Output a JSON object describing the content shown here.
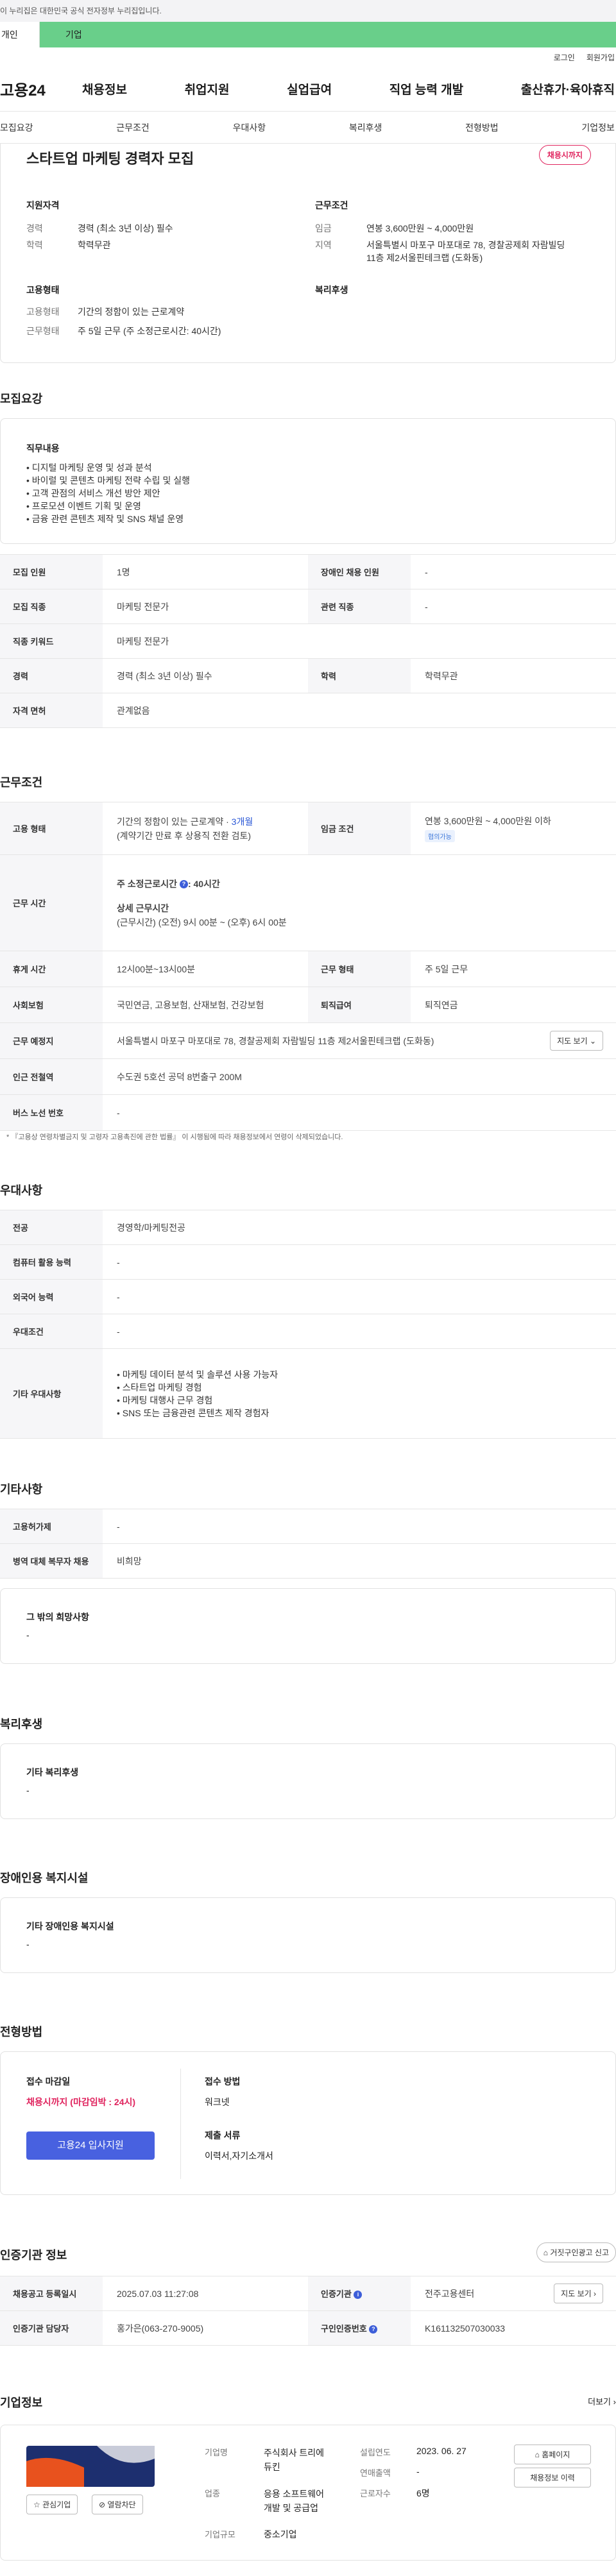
{
  "gov_banner": "이 누리집은 대한민국 공식 전자정부 누리집입니다.",
  "tabs": {
    "personal": "개인",
    "company": "기업"
  },
  "util": {
    "login": "로그인",
    "join": "회원가입"
  },
  "logo": "고용24",
  "gnb": [
    "채용정보",
    "취업지원",
    "실업급여",
    "직업 능력 개발",
    "출산휴가·육아휴직"
  ],
  "anchor_nav": [
    "모집요강",
    "근무조건",
    "우대사항",
    "복리후생",
    "전형방법",
    "기업정보"
  ],
  "summary": {
    "title": "스타트업 마케팅 경력자 모집",
    "status": "채용시까지",
    "qualification_title": "지원자격",
    "career_k": "경력",
    "career_v": "경력 (최소 3년 이상) 필수",
    "education_k": "학력",
    "education_v": "학력무관",
    "employment_title": "고용형태",
    "emp_type_k": "고용형태",
    "emp_type_v": "기간의 정함이 있는 근로계약",
    "work_type_k": "근무형태",
    "work_type_v": "주 5일 근무 (주 소정근로시간: 40시간)",
    "conditions_title": "근무조건",
    "wage_k": "임금",
    "wage_v": "연봉 3,600만원 ~ 4,000만원",
    "region_k": "지역",
    "region_v1": "서울특별시 마포구 마포대로 78, 경찰공제회 자람빌딩",
    "region_v2": "11층 제2서울핀테크랩 (도화동)",
    "welfare_title": "복리후생"
  },
  "recruit": {
    "section_title": "모집요강",
    "duties_title": "직무내용",
    "duties": [
      "디지털 마케팅 운영 및 성과 분석",
      "바이럴 및 콘텐츠 마케팅 전략 수립 및 실행",
      "고객 관점의 서비스 개선 방안 제안",
      "프로모션 이벤트 기획 및 운영",
      "금융 관련 콘텐츠 제작 및 SNS 채널 운영"
    ],
    "headcount_k": "모집 인원",
    "headcount_v": "1명",
    "disabled_k": "장애인 채용 인원",
    "disabled_v": "-",
    "job_k": "모집 직종",
    "job_v": "마케팅 전문가",
    "related_k": "관련 직종",
    "related_v": "-",
    "keyword_k": "직종 키워드",
    "keyword_v": "마케팅 전문가",
    "career_k": "경력",
    "career_v": "경력 (최소 3년 이상) 필수",
    "edu_k": "학력",
    "edu_v": "학력무관",
    "license_k": "자격 면허",
    "license_v": "관계없음"
  },
  "conditions": {
    "section_title": "근무조건",
    "emp_k": "고용 형태",
    "emp_v1a": "기간의 정함이 있는 근로계약 · ",
    "emp_v1b": "3개월",
    "emp_v2": "(계약기간 만료 후 상용직 전환 검토)",
    "wage_k": "임금 조건",
    "wage_v": "연봉 3,600만원 ~ 4,000만원 이하",
    "wage_badge": "협의가능",
    "hours_k": "근무 시간",
    "hours_main": "주 소정근로시간",
    "hours_main_v": ": 40시간",
    "hours_detail_title": "상세 근무시간",
    "hours_detail": "(근무시간) (오전) 9시 00분 ~ (오후) 6시 00분",
    "break_k": "휴게 시간",
    "break_v": "12시00분~13시00분",
    "worktype_k": "근무 형태",
    "worktype_v": "주 5일 근무",
    "insurance_k": "사회보험",
    "insurance_v": "국민연금, 고용보험, 산재보험, 건강보험",
    "severance_k": "퇴직급여",
    "severance_v": "퇴직연금",
    "place_k": "근무 예정지",
    "place_v": "서울특별시 마포구 마포대로 78, 경찰공제회 자람빌딩 11층 제2서울핀테크랩 (도화동)",
    "map_btn": "지도 보기",
    "subway_k": "인근 전철역",
    "subway_v": "수도권 5호선 공덕 8번출구 200M",
    "bus_k": "버스 노선 번호",
    "bus_v": "-",
    "note": "* 『고용상 연령차별금지 및 고령자 고용촉진에 관한 법률』 이 시행됨에 따라 채용정보에서 연령이 삭제되었습니다."
  },
  "preferences": {
    "section_title": "우대사항",
    "major_k": "전공",
    "major_v": "경영학/마케팅전공",
    "computer_k": "컴퓨터 활용 능력",
    "computer_v": "-",
    "language_k": "외국어 능력",
    "language_v": "-",
    "pref_k": "우대조건",
    "pref_v": "-",
    "other_k": "기타 우대사항",
    "other_items": [
      "마케팅 데이터 분석 및 솔루션 사용 가능자",
      "스타트업 마케팅 경험",
      "마케팅 대행사 근무 경험",
      "SNS 또는 금융관련 콘텐츠 제작 경험자"
    ]
  },
  "misc": {
    "section_title": "기타사항",
    "hire_k": "고용허가제",
    "hire_v": "-",
    "military_k": "병역 대체 복무자 채용",
    "military_v": "비희망",
    "wish_title": "그 밖의 희망사항",
    "wish_v": "-"
  },
  "welfare": {
    "section_title": "복리후생",
    "box_title": "기타 복리후생",
    "box_v": "-"
  },
  "disability": {
    "section_title": "장애인용 복지시설",
    "box_title": "기타 장애인용 복지시설",
    "box_v": "-"
  },
  "selection": {
    "section_title": "전형방법",
    "deadline_title": "접수 마감일",
    "deadline_v": "채용시까지 (마감임박 : 24시)",
    "apply_btn": "고용24 입사지원",
    "method_title": "접수 방법",
    "method_v": "워크넷",
    "docs_title": "제출 서류",
    "docs_v": "이력서,자기소개서"
  },
  "certification": {
    "section_title": "인증기관 정보",
    "report_btn": "거짓구인광고 신고",
    "reg_date_k": "채용공고 등록일시",
    "reg_date_v": "2025.07.03 11:27:08",
    "cert_org_k": "인증기관",
    "cert_org_v": "전주고용센터",
    "map_btn": "지도 보기",
    "manager_k": "인증기관 담당자",
    "manager_v": "홍가은(063-270-9005)",
    "cert_no_k": "구인인증번호",
    "cert_no_v": "K161132507030033"
  },
  "company": {
    "section_title": "기업정보",
    "more": "더보기",
    "interest_btn": "관심기업",
    "block_btn": "열람차단",
    "name_k": "기업명",
    "name_v1": "주식회사 트리에",
    "name_v2": "듀킨",
    "industry_k": "업종",
    "industry_v1": "응용 소프트웨어",
    "industry_v2": "개발 및 공급업",
    "size_k": "기업규모",
    "size_v": "중소기업",
    "founded_k": "설립연도",
    "founded_v": "2023. 06. 27",
    "revenue_k": "연매출액",
    "revenue_v": "-",
    "employees_k": "근로자수",
    "employees_v": "6명",
    "homepage_btn": "홈페이지",
    "jobs_btn": "채용정보 이력"
  },
  "colors": {
    "green_tab": "#69cf8a",
    "accent_red": "#e0245e",
    "apply_blue": "#4861e0",
    "link_blue": "#2a57d6"
  }
}
